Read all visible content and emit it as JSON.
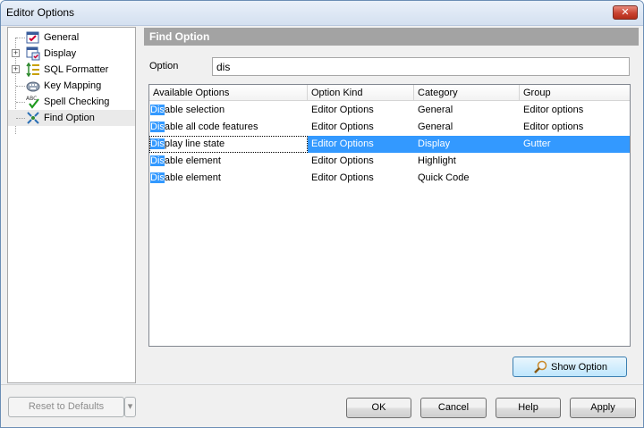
{
  "window": {
    "title": "Editor Options",
    "close_glyph": "✕"
  },
  "tree": {
    "items": [
      {
        "label": "General",
        "icon": "general-icon",
        "expandable": false
      },
      {
        "label": "Display",
        "icon": "display-icon",
        "expandable": true
      },
      {
        "label": "SQL Formatter",
        "icon": "sql-formatter-icon",
        "expandable": true
      },
      {
        "label": "Key Mapping",
        "icon": "key-mapping-icon",
        "expandable": false
      },
      {
        "label": "Spell Checking",
        "icon": "spell-check-icon",
        "expandable": false
      },
      {
        "label": "Find Option",
        "icon": "find-option-icon",
        "expandable": false,
        "selected": true
      }
    ]
  },
  "section": {
    "title": "Find Option"
  },
  "search": {
    "label": "Option",
    "value": "dis"
  },
  "grid": {
    "columns": [
      "Available Options",
      "Option Kind",
      "Category",
      "Group"
    ],
    "rows": [
      {
        "match": "Dis",
        "rest": "able selection",
        "kind": "Editor Options",
        "category": "General",
        "group": "Editor options"
      },
      {
        "match": "Dis",
        "rest": "able all code features",
        "kind": "Editor Options",
        "category": "General",
        "group": "Editor options"
      },
      {
        "match": "Dis",
        "rest": "play line state",
        "kind": "Editor Options",
        "category": "Display",
        "group": "Gutter",
        "selected": true
      },
      {
        "match": "Dis",
        "rest": "able element",
        "kind": "Editor Options",
        "category": "Highlight",
        "group": ""
      },
      {
        "match": "Dis",
        "rest": "able element",
        "kind": "Editor Options",
        "category": "Quick Code",
        "group": ""
      }
    ]
  },
  "buttons": {
    "show_option": "Show Option",
    "reset": "Reset to Defaults",
    "reset_arrow": "▾",
    "ok": "OK",
    "cancel": "Cancel",
    "help": "Help",
    "apply": "Apply"
  },
  "colors": {
    "selection": "#3399ff",
    "header_bar": "#a3a3a3"
  }
}
